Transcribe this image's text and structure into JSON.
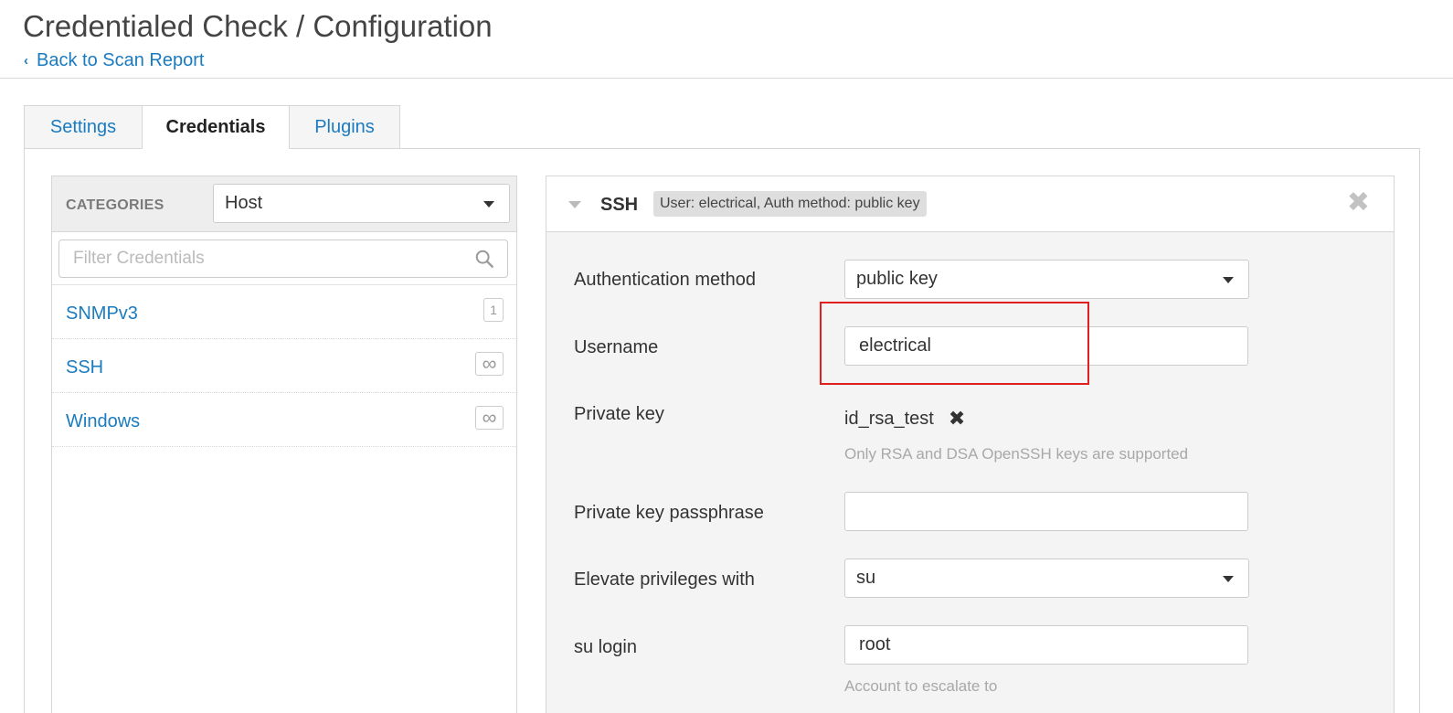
{
  "header": {
    "title": "Credentialed Check / Configuration",
    "back_link": "Back to Scan Report"
  },
  "tabs": [
    {
      "label": "Settings",
      "active": false
    },
    {
      "label": "Credentials",
      "active": true
    },
    {
      "label": "Plugins",
      "active": false
    }
  ],
  "sidebar": {
    "categories_label": "CATEGORIES",
    "category_selected": "Host",
    "filter_placeholder": "Filter Credentials",
    "items": [
      {
        "name": "SNMPv3",
        "count": "1"
      },
      {
        "name": "SSH",
        "count": "∞"
      },
      {
        "name": "Windows",
        "count": "∞"
      }
    ]
  },
  "ssh": {
    "title": "SSH",
    "summary": "User: electrical, Auth method: public key",
    "fields": {
      "auth_method_label": "Authentication method",
      "auth_method_value": "public key",
      "username_label": "Username",
      "username_value": "electrical",
      "private_key_label": "Private key",
      "private_key_file": "id_rsa_test",
      "private_key_help": "Only RSA and DSA OpenSSH keys are supported",
      "passphrase_label": "Private key passphrase",
      "passphrase_value": "",
      "elevate_label": "Elevate privileges with",
      "elevate_value": "su",
      "su_login_label": "su login",
      "su_login_value": "root",
      "su_login_help": "Account to escalate to"
    }
  },
  "colors": {
    "link": "#1a7bbf",
    "highlight": "#e0201f",
    "panel_bg": "#f4f4f4"
  }
}
